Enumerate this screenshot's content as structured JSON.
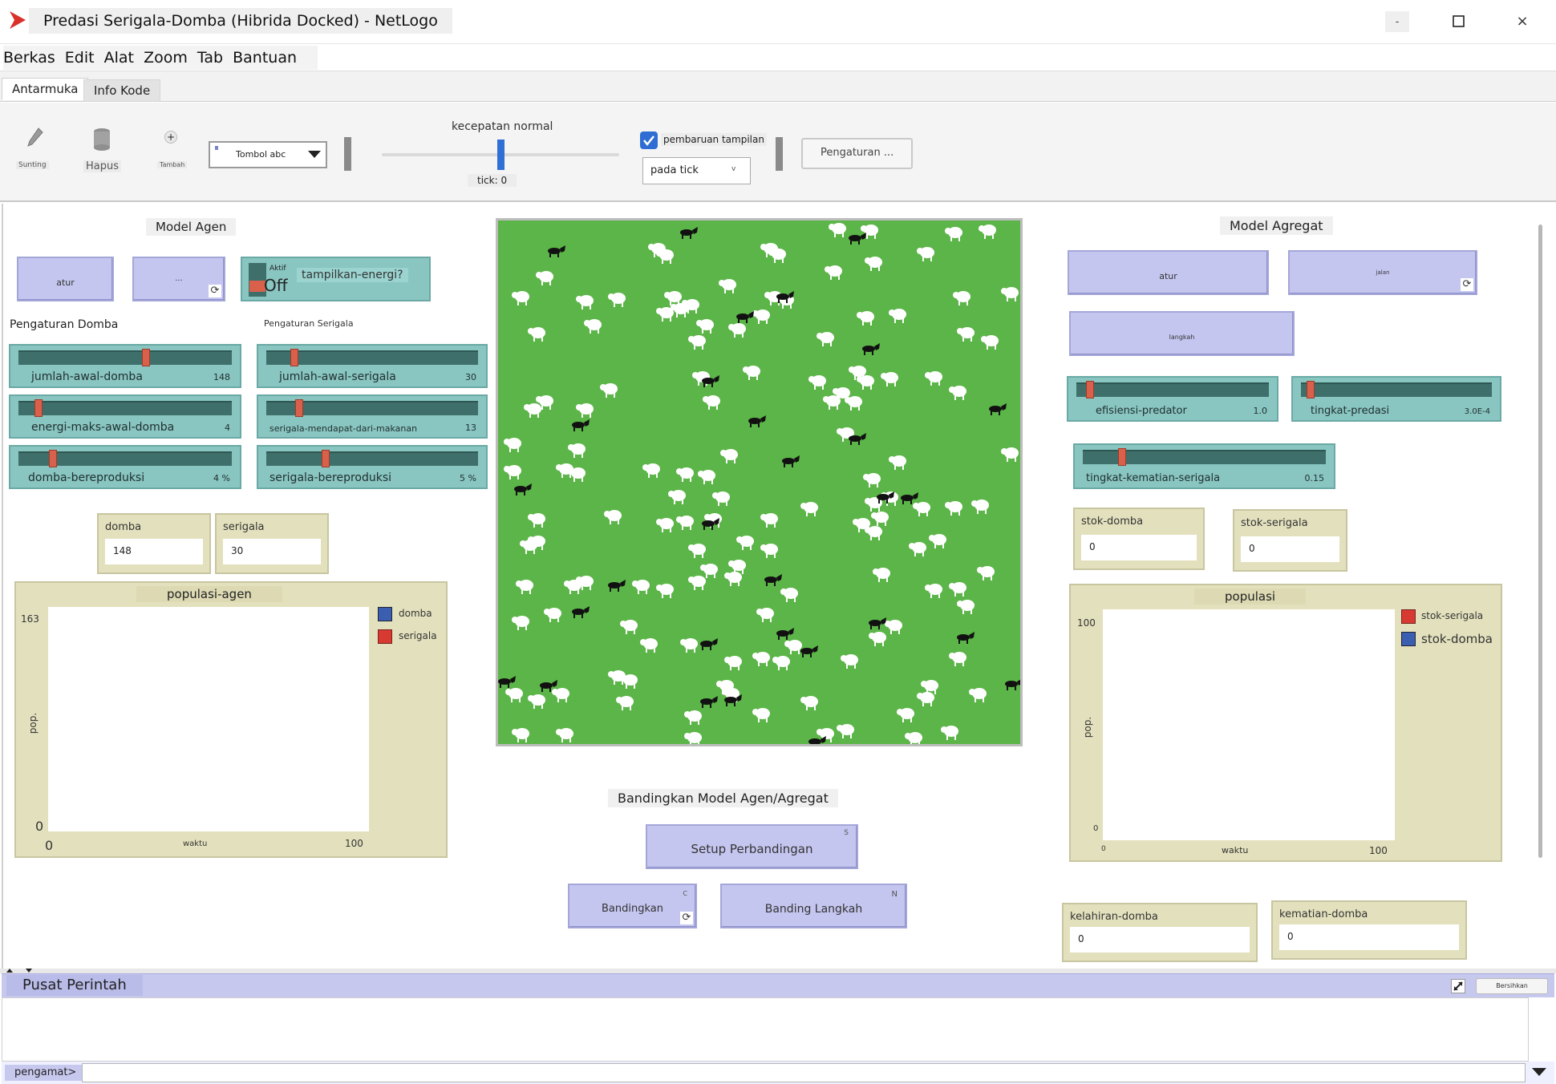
{
  "window": {
    "title": "Predasi Serigala-Domba (Hibrida Docked) - NetLogo",
    "minimize": "-",
    "maximize": "☐",
    "close": "×"
  },
  "menu": {
    "items": [
      "Berkas",
      "Edit",
      "Alat",
      "Zoom",
      "Tab",
      "Bantuan"
    ]
  },
  "tabs": {
    "active": "Antarmuka",
    "other": "Info Kode"
  },
  "toolbar": {
    "edit_label": "Sunting",
    "delete_label": "Hapus",
    "add_label": "Tambah",
    "widget_select": "Tombol abc",
    "speed_label": "kecepatan normal",
    "tick_label": "tick: 0",
    "speed_level": 0.5,
    "view_updates_label": "pembaruan tampilan",
    "view_updates_checked": true,
    "update_mode": "pada tick",
    "update_mode_arrow": "v",
    "settings_label": "Pengaturan ..."
  },
  "agent_model": {
    "title": "Model Agen",
    "setup_label": "atur",
    "go_label": "...",
    "switch_label": "tampilkan-energi?",
    "switch_state": "Off",
    "switch_on_word": "Aktif",
    "sheep_settings": "Pengaturan Domba",
    "wolf_settings": "Pengaturan Serigala",
    "sliders": [
      {
        "label": "jumlah-awal-domba",
        "value": "148",
        "level": 0.6
      },
      {
        "label": "jumlah-awal-serigala",
        "value": "30",
        "level": 0.12
      },
      {
        "label": "energi-maks-awal-domba",
        "value": "4",
        "level": 0.08
      },
      {
        "label": "serigala-mendapat-dari-makanan",
        "value": "13",
        "level": 0.14
      },
      {
        "label": "domba-bereproduksi",
        "value": "4 %",
        "level": 0.15
      },
      {
        "label": "serigala-bereproduksi",
        "value": "5 %",
        "level": 0.27
      }
    ],
    "monitors": [
      {
        "label": "domba",
        "value": "148"
      },
      {
        "label": "serigala",
        "value": "30"
      }
    ],
    "plot": {
      "title": "populasi-agen",
      "y_max": "163",
      "y_min": "0",
      "x_min": "0",
      "x_max": "100",
      "x_label": "waktu",
      "y_label": "pop.",
      "legend": [
        {
          "name": "domba",
          "color": "#3a5fb0"
        },
        {
          "name": "serigala",
          "color": "#d63a30"
        }
      ]
    }
  },
  "aggregate_model": {
    "title": "Model Agregat",
    "setup_label": "atur",
    "go_label": "jalan",
    "step_label": "langkah",
    "sliders": [
      {
        "label": "efisiensi-predator",
        "value": "1.0",
        "level": 0.05
      },
      {
        "label": "tingkat-predasi",
        "value": "3.0E-4",
        "level": 0.03
      },
      {
        "label": "tingkat-kematian-serigala",
        "value": "0.15",
        "level": 0.15
      }
    ],
    "monitors": [
      {
        "label": "stok-domba",
        "value": "0"
      },
      {
        "label": "stok-serigala",
        "value": "0"
      },
      {
        "label": "kelahiran-domba",
        "value": "0"
      },
      {
        "label": "kematian-domba",
        "value": "0"
      }
    ],
    "plot": {
      "title": "populasi",
      "y_max": "100",
      "y_min": "0",
      "x_min": "0",
      "x_max": "100",
      "x_label": "waktu",
      "y_label": "pop.",
      "legend": [
        {
          "name": "stok-serigala",
          "color": "#d63a30"
        },
        {
          "name": "stok-domba",
          "color": "#3a5fb0"
        }
      ]
    }
  },
  "compare": {
    "title": "Bandingkan Model Agen/Agregat",
    "setup_label": "Setup Perbandingan",
    "setup_key": "S",
    "compare_label": "Bandingkan",
    "compare_key": "C",
    "step_label": "Banding Langkah",
    "step_key": "N"
  },
  "command_center": {
    "title": "Pusat Perintah",
    "clear_label": "Bersihkan",
    "prompt": "pengamat>"
  },
  "colors": {
    "button": "#c5c6f0",
    "slider": "#89c5c1",
    "monitor": "#e3e1bd",
    "world": "#5cb548",
    "slider_knob": "#d9614b"
  }
}
